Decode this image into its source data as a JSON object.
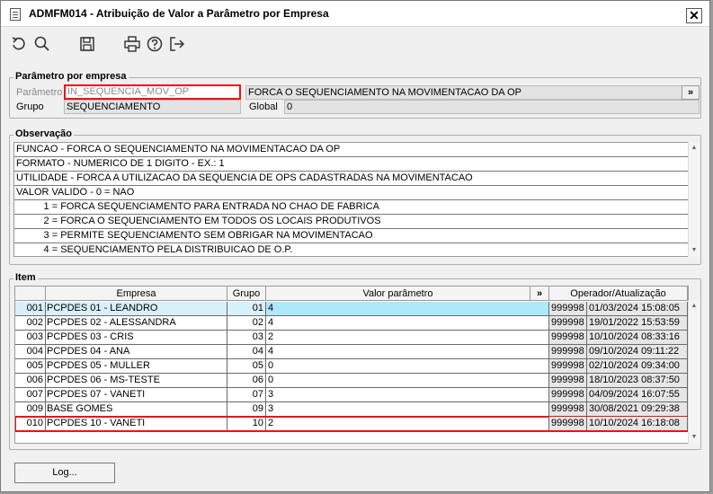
{
  "window": {
    "title": "ADMFM014 - Atribuição de Valor a Parâmetro por Empresa",
    "close_glyph": "✕"
  },
  "toolbar": {
    "icons": [
      "refresh-icon",
      "search-icon",
      "save-icon",
      "print-icon",
      "help-icon",
      "exit-icon"
    ]
  },
  "param_group": {
    "title": "Parâmetro por empresa",
    "parametro_label": "Parâmetro",
    "parametro_value": "IN_SEQUENCIA_MOV_OP",
    "parametro_desc": "FORCA O SEQUENCIAMENTO NA MOVIMENTACAO DA OP",
    "expand_glyph": "»",
    "grupo_label": "Grupo",
    "grupo_value": "SEQUENCIAMENTO",
    "global_label": "Global",
    "global_value": "0"
  },
  "obs_group": {
    "title": "Observação",
    "lines": [
      "FUNCAO - FORCA O SEQUENCIAMENTO NA MOVIMENTACAO DA OP",
      "FORMATO - NUMERICO DE 1 DIGITO - EX.: 1",
      "UTILIDADE - FORCA A UTILIZACAO DA SEQUENCIA DE OPS CADASTRADAS NA MOVIMENTACAO",
      "VALOR VALIDO - 0 = NAO",
      "          1 = FORCA SEQUENCIAMENTO PARA ENTRADA NO CHAO DE FABRICA",
      "          2 = FORCA O SEQUENCIAMENTO EM TODOS OS LOCAIS PRODUTIVOS",
      "          3 = PERMITE SEQUENCIAMENTO SEM OBRIGAR NA MOVIMENTACAO",
      "          4 = SEQUENCIAMENTO PELA DISTRIBUICAO DE O.P."
    ]
  },
  "item_group": {
    "title": "Item",
    "columns": {
      "empresa": "Empresa",
      "grupo": "Grupo",
      "valor": "Valor parâmetro",
      "expand": "»",
      "operador": "Operador/Atualização"
    },
    "rows": [
      {
        "num": "001",
        "empresa": "PCPDES 01 - LEANDRO",
        "grupo": "01",
        "valor": "4",
        "operador": "999998",
        "data": "01/03/2024 15:08:05"
      },
      {
        "num": "002",
        "empresa": "PCPDES 02 - ALESSANDRA",
        "grupo": "02",
        "valor": "4",
        "operador": "999998",
        "data": "19/01/2022 15:53:59"
      },
      {
        "num": "003",
        "empresa": "PCPDES 03 - CRIS",
        "grupo": "03",
        "valor": "2",
        "operador": "999998",
        "data": "10/10/2024 08:33:16"
      },
      {
        "num": "004",
        "empresa": "PCPDES 04 - ANA",
        "grupo": "04",
        "valor": "4",
        "operador": "999998",
        "data": "09/10/2024 09:11:22"
      },
      {
        "num": "005",
        "empresa": "PCPDES 05 - MULLER",
        "grupo": "05",
        "valor": "0",
        "operador": "999998",
        "data": "02/10/2024 09:34:00"
      },
      {
        "num": "006",
        "empresa": "PCPDES 06 - MS-TESTE",
        "grupo": "06",
        "valor": "0",
        "operador": "999998",
        "data": "18/10/2023 08:37:50"
      },
      {
        "num": "007",
        "empresa": "PCPDES 07 - VANETI",
        "grupo": "07",
        "valor": "3",
        "operador": "999998",
        "data": "04/09/2024 16:07:55"
      },
      {
        "num": "009",
        "empresa": "BASE GOMES",
        "grupo": "09",
        "valor": "3",
        "operador": "999998",
        "data": "30/08/2021 09:29:38"
      },
      {
        "num": "010",
        "empresa": "PCPDES 10 - VANETI",
        "grupo": "10",
        "valor": "2",
        "operador": "999998",
        "data": "10/10/2024 16:18:08"
      }
    ]
  },
  "footer": {
    "log_button": "Log..."
  }
}
